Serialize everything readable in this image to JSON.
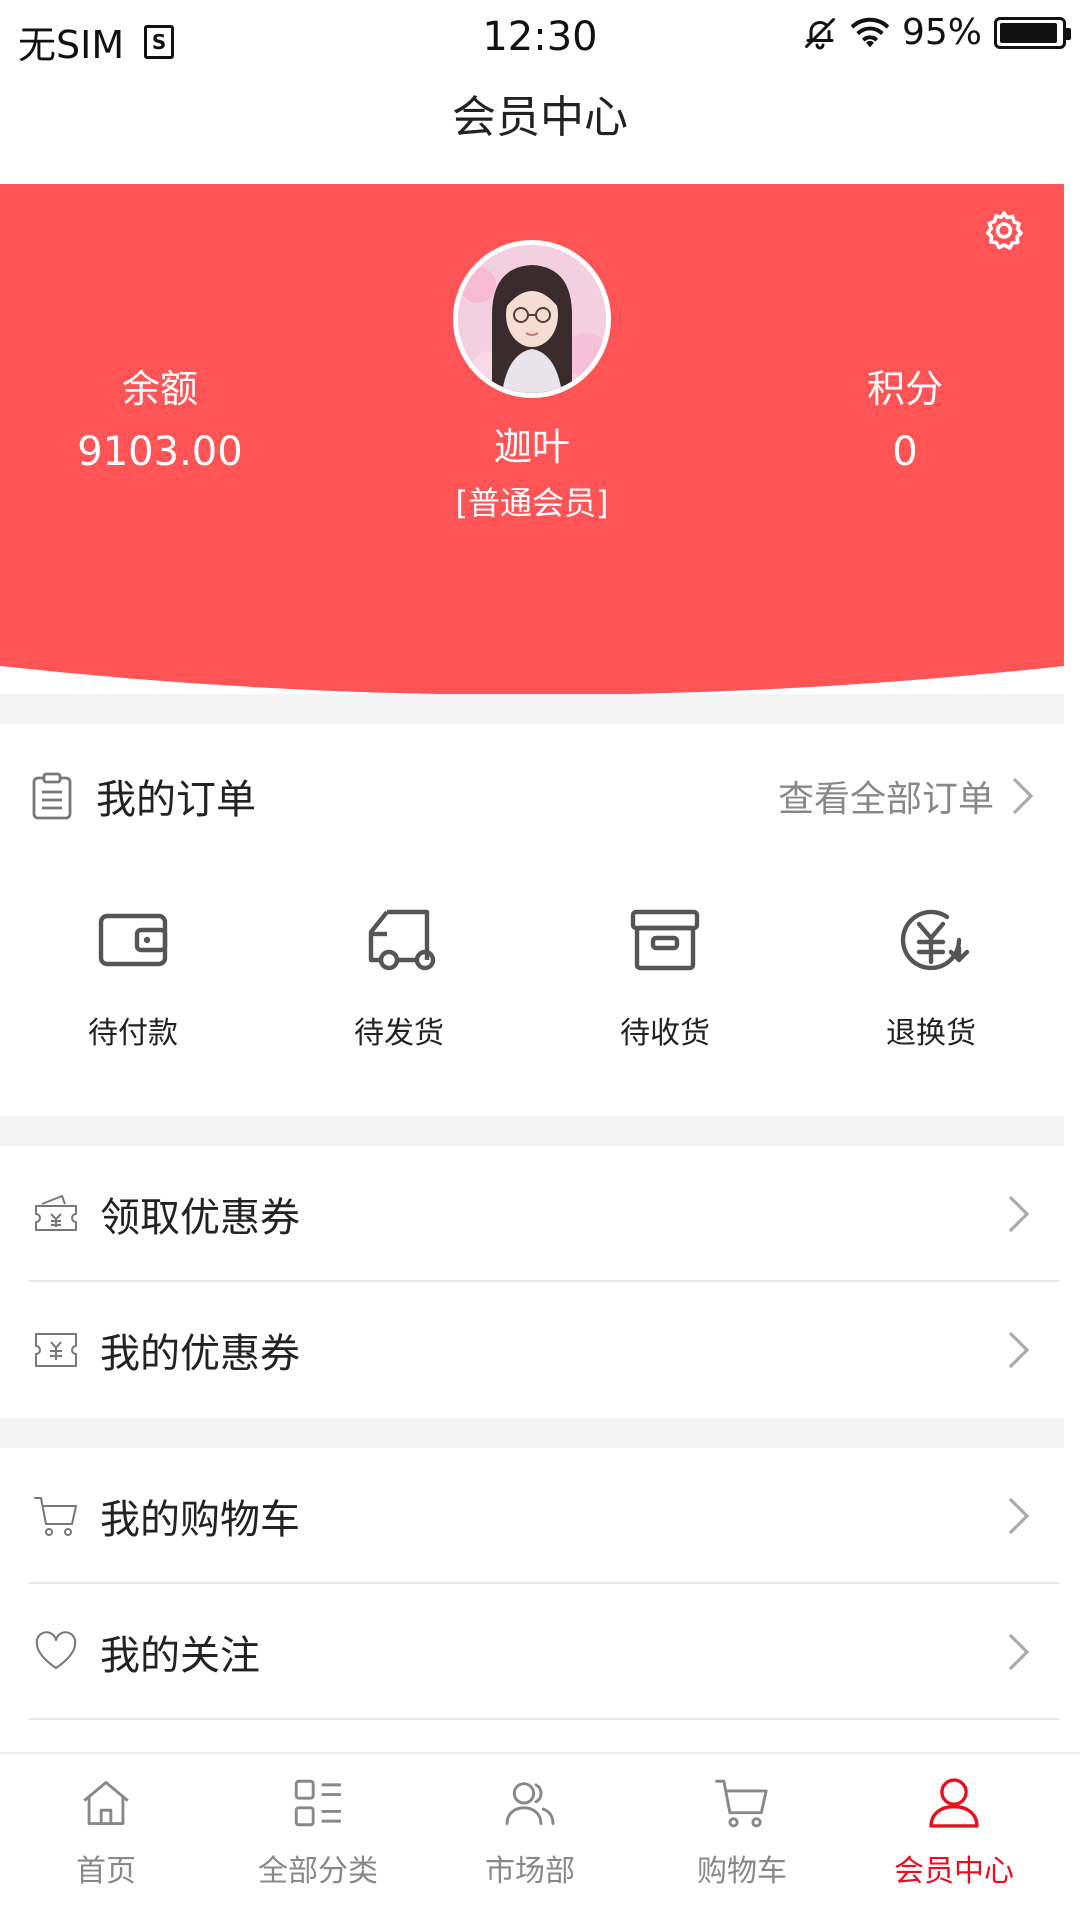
{
  "status_bar": {
    "carrier": "无SIM",
    "sim_badge": "S",
    "time": "12:30",
    "battery": "95%",
    "battery_level": 0.95
  },
  "nav": {
    "title": "会员中心"
  },
  "colors": {
    "brand": "#ff5456",
    "active_tab": "#e8101f",
    "text": "#222222",
    "muted": "#888888"
  },
  "profile": {
    "username": "迦叶",
    "member_level": "[普通会员]",
    "balance_label": "余额",
    "balance_value": "9103.00",
    "points_label": "积分",
    "points_value": "0"
  },
  "orders": {
    "title": "我的订单",
    "view_all": "查看全部订单",
    "items": [
      {
        "label": "待付款",
        "icon": "wallet-icon"
      },
      {
        "label": "待发货",
        "icon": "truck-icon"
      },
      {
        "label": "待收货",
        "icon": "box-icon"
      },
      {
        "label": "退换货",
        "icon": "refund-icon"
      }
    ]
  },
  "menu_group_1": [
    {
      "label": "领取优惠券",
      "icon": "coupon-claim-icon"
    },
    {
      "label": "我的优惠券",
      "icon": "coupon-icon"
    }
  ],
  "menu_group_2": [
    {
      "label": "我的购物车",
      "icon": "cart-icon"
    },
    {
      "label": "我的关注",
      "icon": "heart-icon"
    }
  ],
  "tabs": [
    {
      "label": "首页",
      "icon": "home-icon"
    },
    {
      "label": "全部分类",
      "icon": "category-icon"
    },
    {
      "label": "市场部",
      "icon": "people-icon"
    },
    {
      "label": "购物车",
      "icon": "cart-icon"
    },
    {
      "label": "会员中心",
      "icon": "user-icon",
      "active": true
    }
  ]
}
